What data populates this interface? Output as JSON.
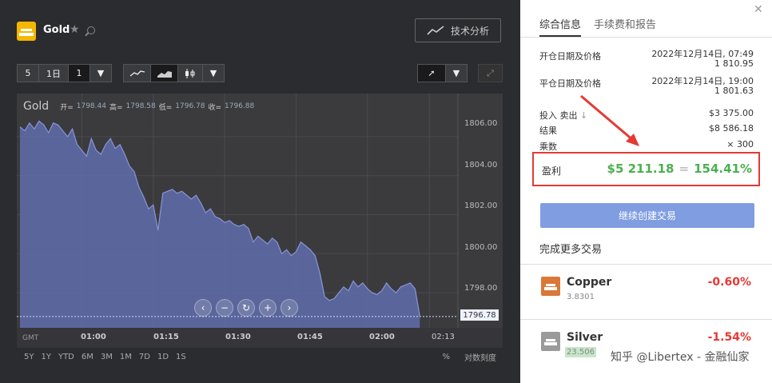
{
  "header": {
    "title": "Gold",
    "tech_button": "技术分析"
  },
  "toolbar": {
    "qty": "5",
    "period": "1日",
    "interval": "1"
  },
  "chart_data": {
    "type": "area",
    "instrument": "Gold",
    "legend": {
      "open_label": "开=",
      "open": "1798.44",
      "high_label": "高=",
      "high": "1798.58",
      "low_label": "低=",
      "low": "1796.78",
      "close_label": "收=",
      "close": "1796.88"
    },
    "y_ticks": [
      "1806.00",
      "1804.00",
      "1802.00",
      "1800.00",
      "1798.00"
    ],
    "y_tick_values": [
      1806,
      1804,
      1802,
      1800,
      1798
    ],
    "current_price": "1796.78",
    "current_price_value": 1796.78,
    "ylim": [
      1796.2,
      1807.8
    ],
    "gmt_label": "GMT",
    "x_ticks": [
      "01:00",
      "01:15",
      "01:30",
      "01:45",
      "02:00",
      "02:13"
    ],
    "x_tick_minutes": [
      60,
      75,
      90,
      105,
      120,
      133
    ],
    "xlim": [
      47,
      139
    ],
    "x": [
      47,
      48,
      49,
      50,
      51,
      52,
      53,
      54,
      55,
      56,
      57,
      58,
      59,
      60,
      61,
      62,
      63,
      64,
      65,
      66,
      67,
      68,
      69,
      70,
      71,
      72,
      73,
      74,
      75,
      76,
      77,
      78,
      79,
      80,
      81,
      82,
      83,
      84,
      85,
      86,
      87,
      88,
      89,
      90,
      91,
      92,
      93,
      94,
      95,
      96,
      97,
      98,
      99,
      100,
      101,
      102,
      103,
      104,
      105,
      106,
      107,
      108,
      109,
      110,
      111,
      112,
      113,
      114,
      115,
      116,
      117,
      118,
      119,
      120,
      121,
      122,
      123,
      124,
      125,
      126,
      127,
      128,
      129,
      130,
      131
    ],
    "values": [
      1806.5,
      1806.3,
      1806.7,
      1806.4,
      1806.8,
      1806.6,
      1806.2,
      1806.7,
      1806.6,
      1806.3,
      1806.0,
      1806.4,
      1805.6,
      1805.3,
      1805.0,
      1805.9,
      1805.3,
      1805.1,
      1805.6,
      1805.9,
      1805.4,
      1805.6,
      1805.1,
      1804.5,
      1804.2,
      1803.4,
      1802.9,
      1802.3,
      1802.5,
      1801.2,
      1803.1,
      1803.2,
      1803.3,
      1803.1,
      1803.2,
      1803.0,
      1802.8,
      1803.0,
      1802.6,
      1802.1,
      1802.3,
      1801.9,
      1801.8,
      1801.6,
      1801.7,
      1801.5,
      1801.4,
      1801.5,
      1801.3,
      1800.6,
      1800.9,
      1800.7,
      1800.5,
      1800.8,
      1800.6,
      1800.0,
      1800.2,
      1799.9,
      1800.1,
      1800.6,
      1800.4,
      1800.2,
      1799.9,
      1799.0,
      1797.8,
      1797.6,
      1797.7,
      1798.0,
      1798.3,
      1798.1,
      1798.6,
      1798.3,
      1798.5,
      1798.2,
      1798.0,
      1797.9,
      1798.1,
      1798.5,
      1798.2,
      1798.0,
      1798.3,
      1798.4,
      1798.5,
      1798.2,
      1796.8
    ]
  },
  "ranges": [
    "5Y",
    "1Y",
    "YTD",
    "6M",
    "3M",
    "1M",
    "7D",
    "1D",
    "1S"
  ],
  "range_right": {
    "pct": "%",
    "scale": "对数刻度"
  },
  "panel": {
    "tab_info": "综合信息",
    "tab_fees": "手续费和报告",
    "open_label": "开仓日期及价格",
    "open_date": "2022年12月14日, 07:49",
    "open_price": "1 810.95",
    "close_label": "平仓日期及价格",
    "close_date": "2022年12月14日, 19:00",
    "close_price": "1 801.63",
    "invest_label": "投入",
    "sell_label": "卖出",
    "invest_value": "$3 375.00",
    "result_label": "结果",
    "result_value": "$8 586.18",
    "mult_label": "乘数",
    "mult_value": "× 300",
    "profit_label": "盈利",
    "profit_value": "$5 211.18",
    "profit_eq": "=",
    "profit_pct": "154.41%",
    "continue_button": "继续创建交易",
    "more_trades": "完成更多交易"
  },
  "assets": [
    {
      "name": "Copper",
      "price": "3.8301",
      "change": "-0.60%"
    },
    {
      "name": "Silver",
      "price": "23.506",
      "change": "-1.54%"
    }
  ],
  "watermark": "知乎 @Libertex - 金融仙家",
  "colors": {
    "accent": "#7f9de0",
    "profit": "#4caf50",
    "loss": "#e53935",
    "highlight": "#e53935"
  }
}
